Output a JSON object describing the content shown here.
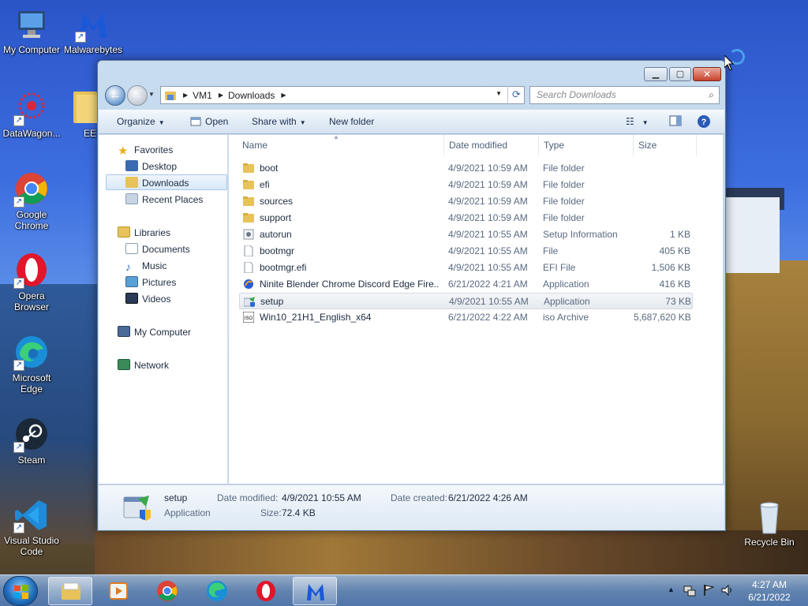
{
  "desktop": {
    "icons": [
      {
        "label": "My Computer",
        "icon": "computer-icon"
      },
      {
        "label": "Malwarebytes",
        "icon": "malwarebytes-icon"
      },
      {
        "label": "DataWagon...",
        "icon": "datawagon-icon"
      },
      {
        "label": "EE",
        "icon": "folder-icon"
      },
      {
        "label": "Google Chrome",
        "icon": "chrome-icon"
      },
      {
        "label": "Opera Browser",
        "icon": "opera-icon"
      },
      {
        "label": "Microsoft Edge",
        "icon": "edge-icon"
      },
      {
        "label": "Steam",
        "icon": "steam-icon"
      },
      {
        "label": "Visual Studio Code",
        "icon": "vscode-icon"
      },
      {
        "label": "Recycle Bin",
        "icon": "recycle-bin-icon"
      }
    ]
  },
  "window": {
    "address": {
      "segments": [
        "VM1",
        "Downloads"
      ]
    },
    "search": {
      "placeholder": "Search Downloads"
    },
    "toolbar": {
      "organize": "Organize",
      "open": "Open",
      "share_with": "Share with",
      "new_folder": "New folder"
    },
    "nav": {
      "favorites": "Favorites",
      "desktop": "Desktop",
      "downloads": "Downloads",
      "recent_places": "Recent Places",
      "libraries": "Libraries",
      "documents": "Documents",
      "music": "Music",
      "pictures": "Pictures",
      "videos": "Videos",
      "my_computer": "My Computer",
      "network": "Network"
    },
    "columns": {
      "name": "Name",
      "date_modified": "Date modified",
      "type": "Type",
      "size": "Size"
    },
    "files": [
      {
        "name": "boot",
        "date": "4/9/2021 10:59 AM",
        "type": "File folder",
        "size": "",
        "icon": "folder-icon"
      },
      {
        "name": "efi",
        "date": "4/9/2021 10:59 AM",
        "type": "File folder",
        "size": "",
        "icon": "folder-icon"
      },
      {
        "name": "sources",
        "date": "4/9/2021 10:59 AM",
        "type": "File folder",
        "size": "",
        "icon": "folder-icon"
      },
      {
        "name": "support",
        "date": "4/9/2021 10:59 AM",
        "type": "File folder",
        "size": "",
        "icon": "folder-icon"
      },
      {
        "name": "autorun",
        "date": "4/9/2021 10:55 AM",
        "type": "Setup Information",
        "size": "1 KB",
        "icon": "setup-info-icon"
      },
      {
        "name": "bootmgr",
        "date": "4/9/2021 10:55 AM",
        "type": "File",
        "size": "405 KB",
        "icon": "file-icon"
      },
      {
        "name": "bootmgr.efi",
        "date": "4/9/2021 10:55 AM",
        "type": "EFI File",
        "size": "1,506 KB",
        "icon": "file-icon"
      },
      {
        "name": "Ninite Blender Chrome Discord Edge Fire...",
        "date": "6/21/2022 4:21 AM",
        "type": "Application",
        "size": "416 KB",
        "icon": "ninite-icon"
      },
      {
        "name": "setup",
        "date": "4/9/2021 10:55 AM",
        "type": "Application",
        "size": "73 KB",
        "icon": "setup-icon"
      },
      {
        "name": "Win10_21H1_English_x64",
        "date": "6/21/2022 4:22 AM",
        "type": "iso Archive",
        "size": "5,687,620 KB",
        "icon": "iso-icon"
      }
    ],
    "details": {
      "name": "setup",
      "type": "Application",
      "date_modified_label": "Date modified:",
      "date_modified": "4/9/2021 10:55 AM",
      "size_label": "Size:",
      "size": "72.4 KB",
      "date_created_label": "Date created:",
      "date_created": "6/21/2022 4:26 AM"
    }
  },
  "taskbar": {
    "clock_time": "4:27 AM",
    "clock_date": "6/21/2022",
    "tray_expand": "▲"
  },
  "colors": {
    "selection": "#d9e9fa",
    "accent": "#3a6aa8"
  }
}
